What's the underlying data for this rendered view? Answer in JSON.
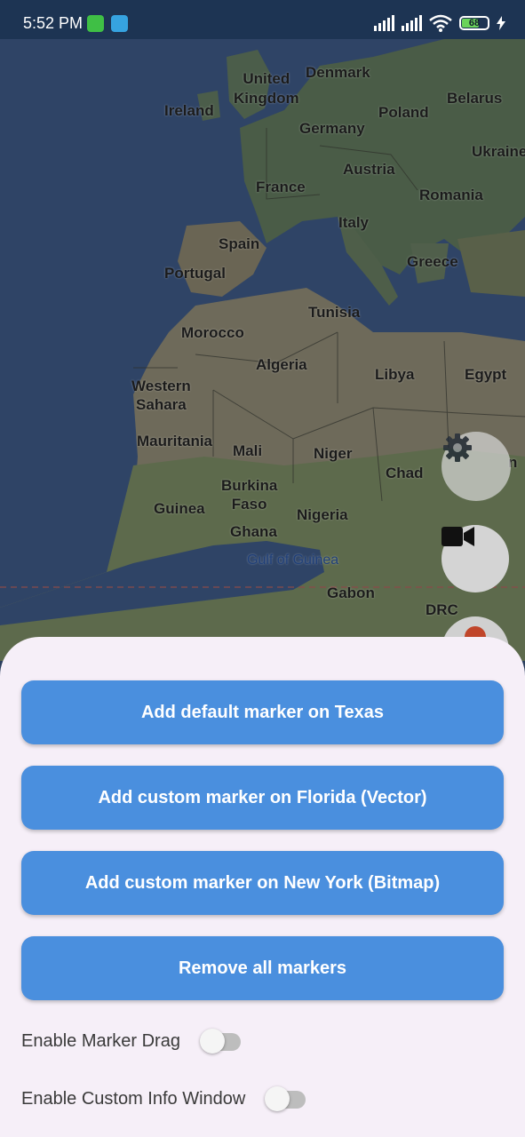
{
  "status_bar": {
    "time": "5:52 PM",
    "battery_level": "68",
    "icons": [
      "android-app-icon",
      "telegram-icon",
      "signal-icon",
      "signal-icon",
      "wifi-icon",
      "battery-icon",
      "charging-bolt-icon"
    ]
  },
  "map": {
    "labels": {
      "united_kingdom": "United\nKingdom",
      "ireland": "Ireland",
      "denmark": "Denmark",
      "belarus": "Belarus",
      "poland": "Poland",
      "germany": "Germany",
      "ukraine": "Ukraine",
      "austria": "Austria",
      "france": "France",
      "romania": "Romania",
      "italy": "Italy",
      "spain": "Spain",
      "portugal": "Portugal",
      "greece": "Greece",
      "tunisia": "Tunisia",
      "morocco": "Morocco",
      "algeria": "Algeria",
      "libya": "Libya",
      "egypt": "Egypt",
      "western_sahara": "Western\nSahara",
      "mauritania": "Mauritania",
      "mali": "Mali",
      "niger": "Niger",
      "chad": "Chad",
      "burkina_faso": "Burkina\nFaso",
      "guinea": "Guinea",
      "nigeria": "Nigeria",
      "ghana": "Ghana",
      "gulf_of_guinea": "Gulf of Guinea",
      "gabon": "Gabon",
      "drc": "DRC",
      "sudan_partial": "n"
    },
    "controls": {
      "settings_icon": "gear-icon",
      "camera_icon": "video-camera-icon"
    }
  },
  "sheet": {
    "buttons": [
      {
        "label": "Add default marker on Texas"
      },
      {
        "label": "Add custom marker on Florida (Vector)"
      },
      {
        "label": "Add custom marker on New York (Bitmap)"
      },
      {
        "label": "Remove all markers"
      }
    ],
    "toggles": [
      {
        "label": "Enable Marker Drag",
        "on": false
      },
      {
        "label": "Enable Custom Info Window",
        "on": false
      }
    ]
  },
  "colors": {
    "button_bg": "#4a8fde",
    "sheet_bg": "#f6eff8",
    "status_bar_bg": "#1d3453"
  }
}
